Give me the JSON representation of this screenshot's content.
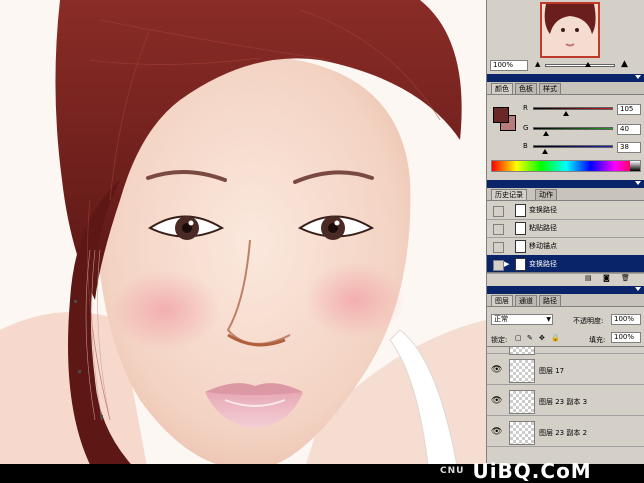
{
  "navigator": {
    "zoom": "100%"
  },
  "color_panel": {
    "tabs": [
      "颜色",
      "色板",
      "样式"
    ],
    "channels": [
      {
        "label": "R",
        "value": "105",
        "level": 0.41,
        "color": "#c81e1e"
      },
      {
        "label": "G",
        "value": "40",
        "level": 0.16,
        "color": "#22a022"
      },
      {
        "label": "B",
        "value": "38",
        "level": 0.15,
        "color": "#2222c0"
      }
    ],
    "foreground": "#692826",
    "background": "#b87b7b"
  },
  "history_panel": {
    "tabs": [
      "历史记录",
      "动作"
    ],
    "items": [
      {
        "label": "变换路径",
        "selected": false
      },
      {
        "label": "粘贴路径",
        "selected": false
      },
      {
        "label": "移动锚点",
        "selected": false
      },
      {
        "label": "变换路径",
        "selected": true
      }
    ]
  },
  "layers_panel": {
    "tabs": [
      "图层",
      "通道",
      "路径"
    ],
    "blend_mode": "正常",
    "opacity_label": "不透明度:",
    "opacity": "100%",
    "lock_label": "锁定:",
    "fill_label": "填充:",
    "fill": "100%",
    "layers": [
      {
        "label": "图层 17"
      },
      {
        "label": "图层 23 副本 3"
      },
      {
        "label": "图层 23 副本 2"
      }
    ]
  },
  "watermark": {
    "prefix": "CNU",
    "logo": "UiBQ.CoM"
  },
  "colors": {
    "panel_bg": "#d4d0c8",
    "titlebar": "#0a246a",
    "hair": "#6b1f1c",
    "skin": "#f6dccf"
  }
}
